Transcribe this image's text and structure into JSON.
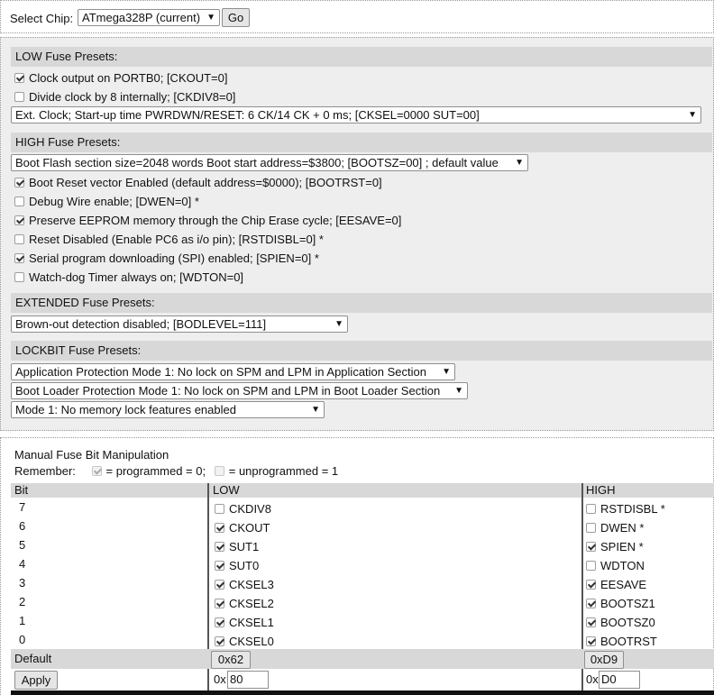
{
  "chip": {
    "label": "Select Chip:",
    "selected": "ATmega328P (current)",
    "go": "Go"
  },
  "low": {
    "title": "LOW Fuse Presets:",
    "ckout": {
      "label": "Clock output on PORTB0; [CKOUT=0]",
      "checked": true
    },
    "ckdiv8": {
      "label": "Divide clock by 8 internally; [CKDIV8=0]",
      "checked": false
    },
    "clock_select": "Ext. Clock; Start-up time PWRDWN/RESET: 6 CK/14 CK + 0 ms; [CKSEL=0000 SUT=00]"
  },
  "high": {
    "title": "HIGH Fuse Presets:",
    "bootsz_select": "Boot Flash section size=2048 words Boot start address=$3800; [BOOTSZ=00] ; default value",
    "items": [
      {
        "label": "Boot Reset vector Enabled (default address=$0000); [BOOTRST=0]",
        "checked": true
      },
      {
        "label": "Debug Wire enable; [DWEN=0] *",
        "checked": false
      },
      {
        "label": "Preserve EEPROM memory through the Chip Erase cycle; [EESAVE=0]",
        "checked": true
      },
      {
        "label": "Reset Disabled (Enable PC6 as i/o pin); [RSTDISBL=0] *",
        "checked": false
      },
      {
        "label": "Serial program downloading (SPI) enabled; [SPIEN=0] *",
        "checked": true
      },
      {
        "label": "Watch-dog Timer always on; [WDTON=0]",
        "checked": false
      }
    ]
  },
  "extended": {
    "title": "EXTENDED Fuse Presets:",
    "bod_select": "Brown-out detection disabled; [BODLEVEL=111]"
  },
  "lockbit": {
    "title": "LOCKBIT Fuse Presets:",
    "app_select": "Application Protection Mode 1: No lock on SPM and LPM in Application Section",
    "boot_select": "Boot Loader Protection Mode 1: No lock on SPM and LPM in Boot Loader Section",
    "mem_select": "Mode 1: No memory lock features enabled"
  },
  "manual": {
    "title": "Manual Fuse Bit Manipulation",
    "remember_label": "Remember:",
    "programmed_text": "= programmed = 0;",
    "unprogrammed_text": "= unprogrammed = 1",
    "columns": {
      "bit": "Bit",
      "low": "LOW",
      "high": "HIGH"
    },
    "rows": [
      {
        "bit": "7",
        "low": "CKDIV8",
        "low_on": false,
        "high": "RSTDISBL *",
        "high_on": false
      },
      {
        "bit": "6",
        "low": "CKOUT",
        "low_on": true,
        "high": "DWEN *",
        "high_on": false
      },
      {
        "bit": "5",
        "low": "SUT1",
        "low_on": true,
        "high": "SPIEN *",
        "high_on": true
      },
      {
        "bit": "4",
        "low": "SUT0",
        "low_on": true,
        "high": "WDTON",
        "high_on": false
      },
      {
        "bit": "3",
        "low": "CKSEL3",
        "low_on": true,
        "high": "EESAVE",
        "high_on": true
      },
      {
        "bit": "2",
        "low": "CKSEL2",
        "low_on": true,
        "high": "BOOTSZ1",
        "high_on": true
      },
      {
        "bit": "1",
        "low": "CKSEL1",
        "low_on": true,
        "high": "BOOTSZ0",
        "high_on": true
      },
      {
        "bit": "0",
        "low": "CKSEL0",
        "low_on": true,
        "high": "BOOTRST",
        "high_on": true
      }
    ],
    "default_label": "Default",
    "low_default": "0x62",
    "high_default": "0xD9",
    "apply": "Apply",
    "hex_prefix": "0x",
    "low_value": "80",
    "high_value": "D0"
  }
}
